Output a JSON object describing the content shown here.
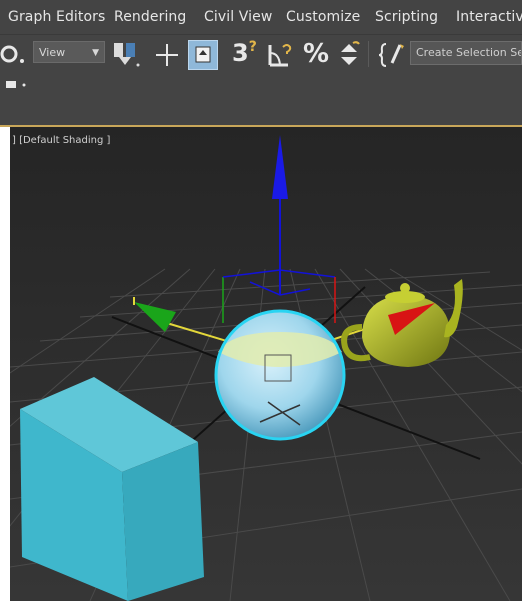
{
  "menubar": {
    "items": [
      {
        "pre": "Graph Ed",
        "acc": "",
        "post": "itors",
        "full": "Graph Editors"
      },
      {
        "pre": "",
        "acc": "R",
        "post": "endering",
        "full": "Rendering"
      },
      {
        "pre": "",
        "acc": "",
        "post": "Civil View",
        "full": "Civil View"
      },
      {
        "pre": "",
        "acc": "C",
        "post": "ustomize",
        "full": "Customize"
      },
      {
        "pre": "",
        "acc": "S",
        "post": "cripting",
        "full": "Scripting"
      },
      {
        "pre": "",
        "acc": "",
        "post": "Interactive",
        "full": "Interactive"
      }
    ]
  },
  "toolbar": {
    "view_select": "View",
    "angle_snap": "3",
    "percent_snap": "%",
    "selection_set_placeholder": "Create Selection Se"
  },
  "viewport": {
    "label": "] [Default Shading ]"
  },
  "colors": {
    "ui_bg": "#444444",
    "viewport_bg": "#2b2b2b",
    "active_button": "#8fb8d9",
    "selection_outline": "#29d4f2",
    "axis_z": "#1212d8",
    "axis_x": "#d81414",
    "axis_y": "#1aa51a",
    "box": "#3fb7cc",
    "teapot": "#b6c021",
    "sphere": "#9fd6ec"
  }
}
